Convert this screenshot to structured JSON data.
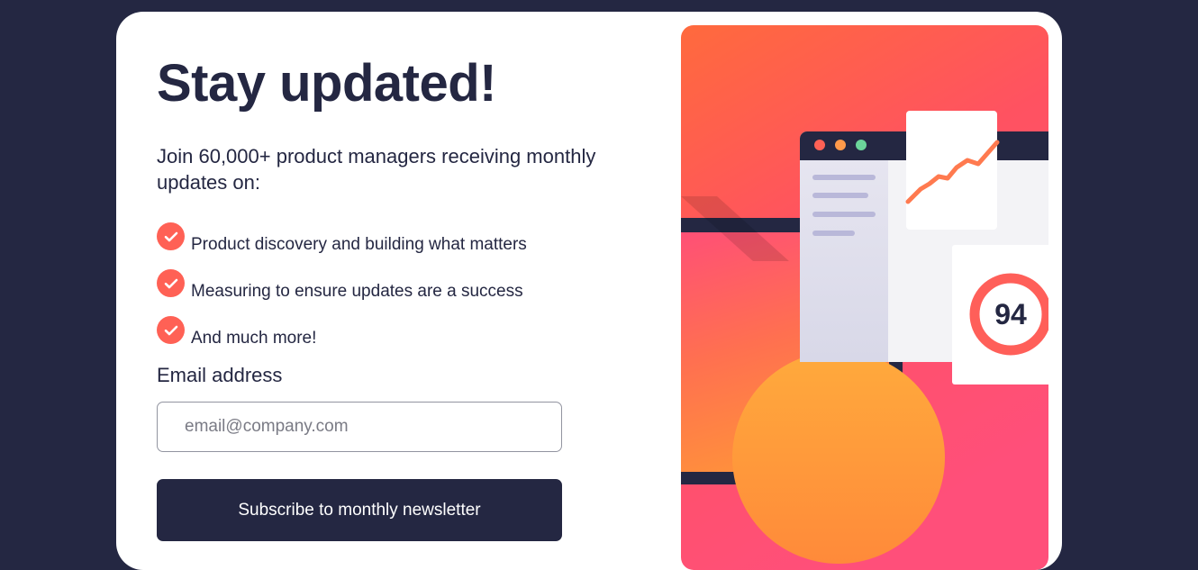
{
  "card": {
    "title": "Stay updated!",
    "intro": "Join 60,000+ product managers receiving monthly updates on:",
    "features": [
      "Product discovery and building what matters",
      "Measuring to ensure updates are a success",
      "And much more!"
    ],
    "form": {
      "email_label": "Email address",
      "email_placeholder": "email@company.com",
      "email_value": "",
      "submit_label": "Subscribe to monthly newsletter"
    },
    "illustration": {
      "score": "94"
    }
  },
  "colors": {
    "background": "#242742",
    "accent": "#ff6155",
    "text": "#242742",
    "card": "#ffffff"
  },
  "icons": {
    "feature_check": "check-circle-icon"
  }
}
